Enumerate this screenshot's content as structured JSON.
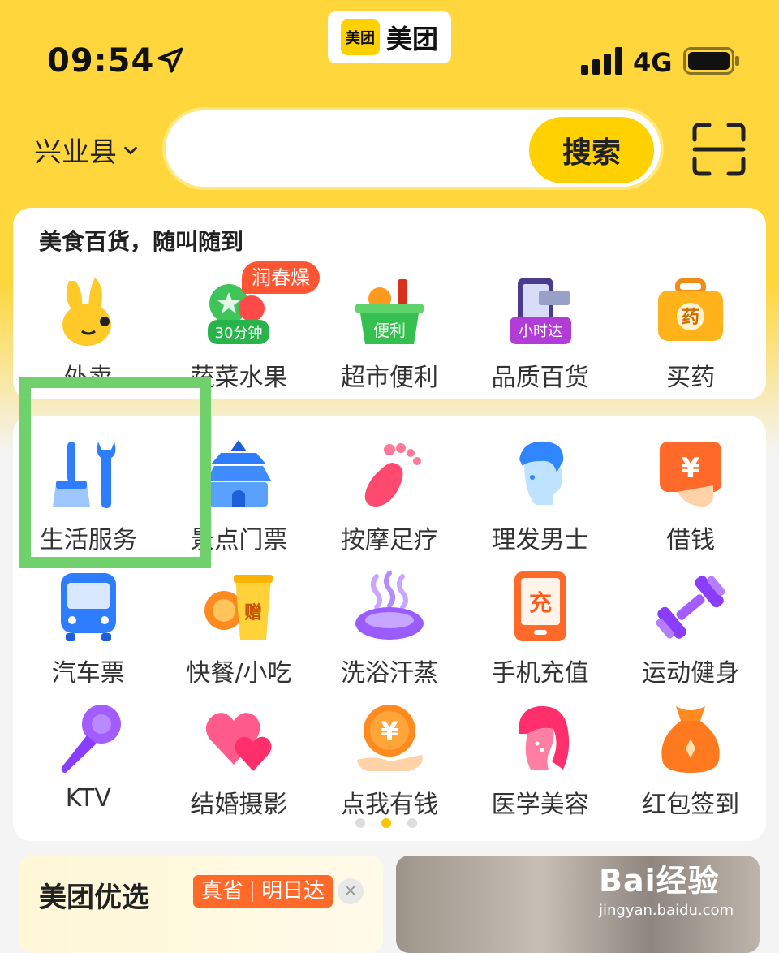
{
  "status_bar": {
    "time": "09:54",
    "network": "4G"
  },
  "app_badge": {
    "logo_text": "美团",
    "name": "美团"
  },
  "header": {
    "city": "兴业县",
    "search_placeholder": "",
    "search_button": "搜索"
  },
  "card1": {
    "title": "美食百货，随叫随到",
    "items": [
      {
        "label": "外卖",
        "icon": "takeout-rabbit-icon"
      },
      {
        "label": "蔬菜水果",
        "icon": "vegetable-fruit-icon",
        "badge": "30分钟",
        "tag": "润春燥"
      },
      {
        "label": "超市便利",
        "icon": "supermarket-basket-icon",
        "badge": "便利"
      },
      {
        "label": "品质百货",
        "icon": "phone-box-icon",
        "badge": "小时达"
      },
      {
        "label": "买药",
        "icon": "medicine-box-icon",
        "badge": "药"
      }
    ]
  },
  "card2": {
    "rows": [
      [
        {
          "label": "生活服务",
          "icon": "broom-wrench-icon"
        },
        {
          "label": "景点门票",
          "icon": "temple-icon"
        },
        {
          "label": "按摩足疗",
          "icon": "foot-icon"
        },
        {
          "label": "理发男士",
          "icon": "man-hair-icon"
        },
        {
          "label": "借钱",
          "icon": "yen-card-icon"
        }
      ],
      [
        {
          "label": "汽车票",
          "icon": "bus-icon"
        },
        {
          "label": "快餐/小吃",
          "icon": "noodle-cup-icon",
          "badge": "赠"
        },
        {
          "label": "洗浴汗蒸",
          "icon": "bath-steam-icon"
        },
        {
          "label": "手机充值",
          "icon": "phone-charge-icon",
          "badge": "充"
        },
        {
          "label": "运动健身",
          "icon": "dumbbell-icon"
        }
      ],
      [
        {
          "label": "KTV",
          "icon": "microphone-icon"
        },
        {
          "label": "结婚摄影",
          "icon": "hearts-icon"
        },
        {
          "label": "点我有钱",
          "icon": "coin-hand-icon"
        },
        {
          "label": "医学美容",
          "icon": "woman-face-icon"
        },
        {
          "label": "红包签到",
          "icon": "money-bag-icon"
        }
      ]
    ],
    "page_count": 3,
    "active_page": 1
  },
  "bottom": {
    "title": "美团优选",
    "tags": [
      "真省",
      "明日达"
    ],
    "close": "×"
  },
  "watermark": {
    "brand": "Bai经验",
    "url": "jingyan.baidu.com"
  },
  "colors": {
    "brand_yellow": "#ffd100",
    "highlight_green": "#6fd06c",
    "tag_red": "#ff5533"
  }
}
